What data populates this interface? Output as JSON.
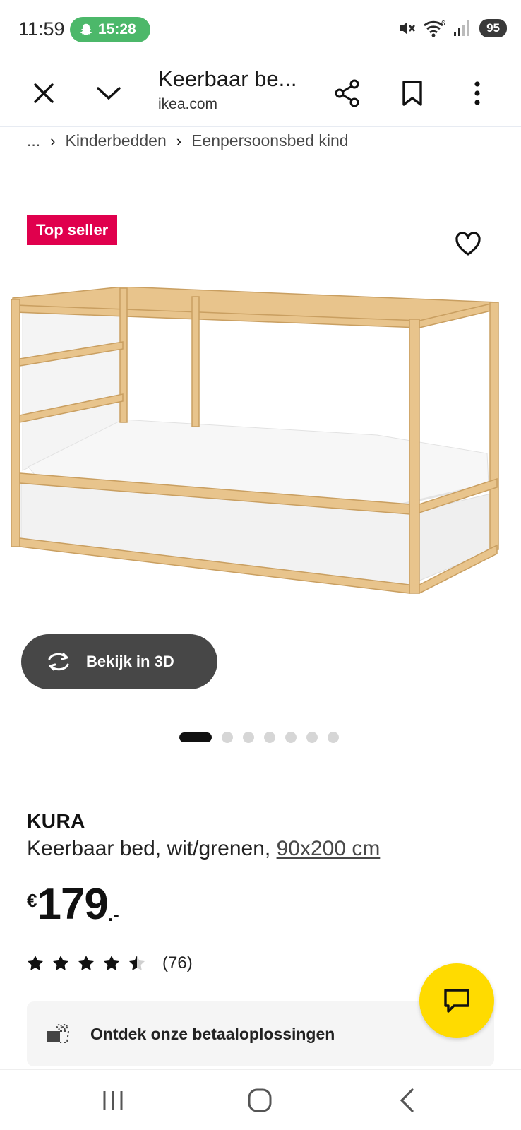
{
  "status_bar": {
    "time": "11:59",
    "snap_timer": "15:28",
    "battery": "95"
  },
  "toolbar": {
    "page_title": "Keerbaar be...",
    "domain": "ikea.com",
    "icons": [
      "close-icon",
      "chevron-down-icon",
      "share-icon",
      "bookmark-icon",
      "more-icon"
    ]
  },
  "breadcrumb": {
    "ellipsis": "...",
    "items": [
      "Kinderbedden",
      "Eenpersoonsbed kind"
    ]
  },
  "product": {
    "badge": "Top seller",
    "view_3d_label": "Bekijk in 3D",
    "carousel_pages": 7,
    "carousel_active": 1,
    "brand": "KURA",
    "description": "Keerbaar bed, wit/grenen,",
    "size_link": "90x200 cm",
    "price_currency": "€",
    "price_amount": "179",
    "price_suffix": ".-",
    "rating_value": 4.5,
    "rating_max": 5,
    "review_count": "(76)",
    "payment_label": "Ontdek onze betaaloplossingen"
  },
  "colors": {
    "badge_red": "#e0004d",
    "chat_yellow": "#ffdb00",
    "snap_green": "#4cb86a",
    "pine": "#e8c48c"
  }
}
